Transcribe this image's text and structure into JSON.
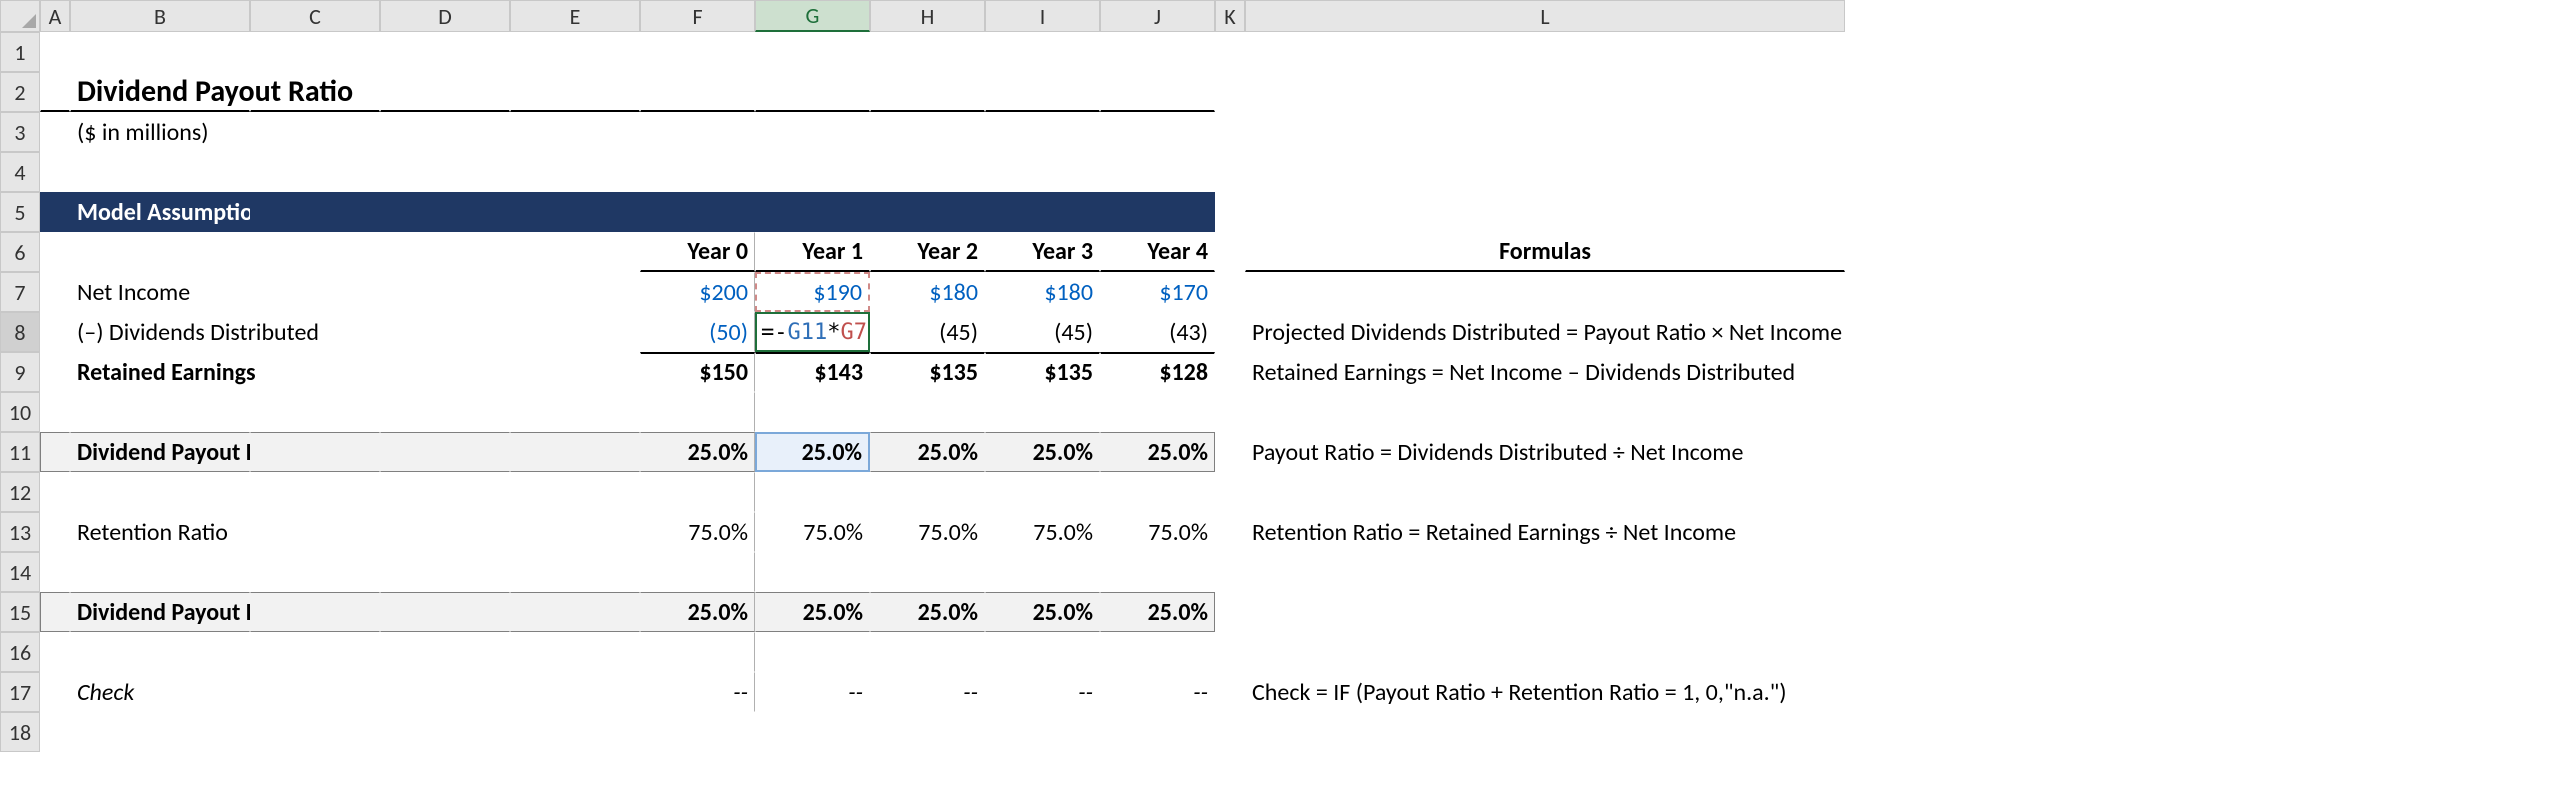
{
  "cols": [
    "A",
    "B",
    "C",
    "D",
    "E",
    "F",
    "G",
    "H",
    "I",
    "J",
    "K",
    "L"
  ],
  "rows": [
    "1",
    "2",
    "3",
    "4",
    "5",
    "6",
    "7",
    "8",
    "9",
    "10",
    "11",
    "12",
    "13",
    "14",
    "15",
    "16",
    "17",
    "18"
  ],
  "title": "Dividend Payout Ratio",
  "subtitle": "($ in millions)",
  "section": "Model Assumptions",
  "yearHdr": {
    "F": "Year 0",
    "G": "Year 1",
    "H": "Year 2",
    "I": "Year 3",
    "J": "Year 4",
    "L": "Formulas"
  },
  "r7": {
    "label": "Net Income",
    "F": "$200",
    "G": "$190",
    "H": "$180",
    "I": "$180",
    "J": "$170"
  },
  "r8": {
    "label": "(–) Dividends Distributed",
    "F": "(50)",
    "H": "(45)",
    "I": "(45)",
    "J": "(43)",
    "L": "Projected Dividends Distributed = Payout Ratio × Net Income",
    "formula": {
      "eq": "=",
      "neg": "-",
      "ref1": "G11",
      "op": "*",
      "ref2": "G7"
    }
  },
  "r9": {
    "label": "Retained Earnings",
    "F": "$150",
    "G": "$143",
    "H": "$135",
    "I": "$135",
    "J": "$128",
    "L": "Retained Earnings = Net Income – Dividends Distributed"
  },
  "r11": {
    "label": "Dividend Payout Ratio",
    "F": "25.0%",
    "G": "25.0%",
    "H": "25.0%",
    "I": "25.0%",
    "J": "25.0%",
    "L": "Payout Ratio = Dividends Distributed ÷ Net Income"
  },
  "r13": {
    "label": "Retention Ratio",
    "F": "75.0%",
    "G": "75.0%",
    "H": "75.0%",
    "I": "75.0%",
    "J": "75.0%",
    "L": "Retention Ratio = Retained Earnings ÷ Net Income"
  },
  "r15": {
    "label": "Dividend Payout Ratio – Alternative Formula",
    "F": "25.0%",
    "G": "25.0%",
    "H": "25.0%",
    "I": "25.0%",
    "J": "25.0%"
  },
  "r17": {
    "label": "Check",
    "F": "--",
    "G": "--",
    "H": "--",
    "I": "--",
    "J": "--",
    "L": "Check = IF (Payout Ratio + Retention Ratio = 1, 0,\"n.a.\")"
  },
  "selectedCol": "G",
  "selectedRow": "8"
}
